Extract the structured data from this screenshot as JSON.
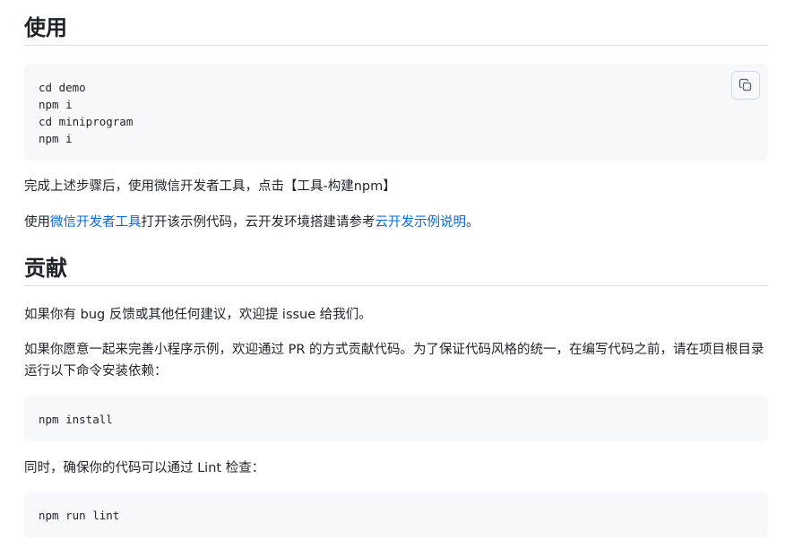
{
  "sections": {
    "usage": {
      "heading": "使用",
      "code_lines": [
        "cd demo",
        "npm i",
        "cd miniprogram",
        "npm i"
      ],
      "copy_icon": "copy-icon",
      "para1": "完成上述步骤后，使用微信开发者工具，点击【工具-构建npm】",
      "para2_prefix": "使用",
      "para2_link1": "微信开发者工具",
      "para2_middle": "打开该示例代码，云开发环境搭建请参考",
      "para2_link2": "云开发示例说明",
      "para2_suffix": "。"
    },
    "contribute": {
      "heading": "贡献",
      "para1": "如果你有 bug 反馈或其他任何建议，欢迎提 issue 给我们。",
      "para2": "如果你愿意一起来完善小程序示例，欢迎通过 PR 的方式贡献代码。为了保证代码风格的统一，在编写代码之前，请在项目根目录运行以下命令安装依赖：",
      "install_cmd": "npm install",
      "para3": "同时，确保你的代码可以通过 Lint 检查：",
      "lint_cmd": "npm run lint"
    }
  },
  "colors": {
    "link": "#0969da",
    "text": "#1f2328",
    "code_bg": "#f6f8fa",
    "divider": "#d8dee4"
  }
}
